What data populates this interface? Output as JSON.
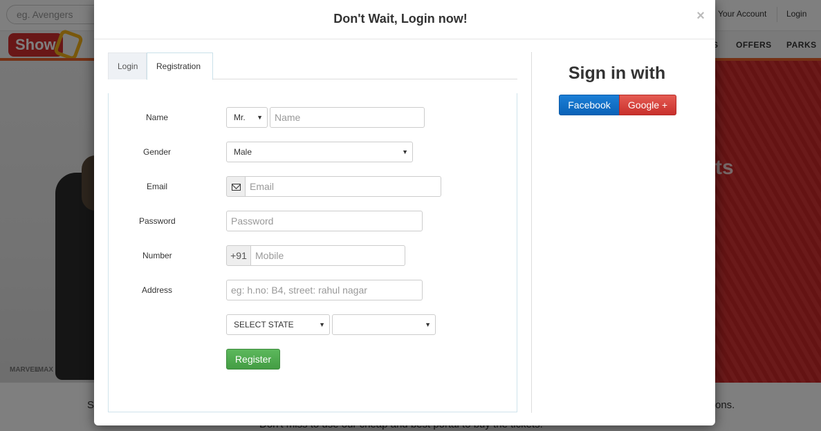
{
  "background": {
    "search_placeholder": "eg. Avengers",
    "top_links": [
      "Your Account",
      "Login"
    ],
    "logo_text": "Show",
    "nav_partial": "S",
    "nav_links": [
      "OFFERS",
      "PARKS"
    ],
    "brands": [
      "MARVEL",
      "IMAX"
    ],
    "hero_text": "ts",
    "bottom_s": "S",
    "bottom_ons": "ons.",
    "bottom_line": "Don't miss to use our cheap and best portal to buy the tickets."
  },
  "modal": {
    "title": "Don't Wait, Login now!",
    "close": "×",
    "tabs": [
      {
        "label": "Login",
        "active": false
      },
      {
        "label": "Registration",
        "active": true
      }
    ],
    "form": {
      "name_label": "Name",
      "title_select_value": "Mr.",
      "name_placeholder": "Name",
      "gender_label": "Gender",
      "gender_value": "Male",
      "email_label": "Email",
      "email_icon": "envelope-icon",
      "email_placeholder": "Email",
      "password_label": "Password",
      "password_placeholder": "Password",
      "number_label": "Number",
      "country_code": "+91",
      "mobile_placeholder": "Mobile",
      "address_label": "Address",
      "address_placeholder": "eg: h.no: B4, street: rahul nagar",
      "state_select_value": "SELECT STATE",
      "city_select_value": "",
      "register_label": "Register"
    },
    "signin": {
      "title": "Sign in with",
      "facebook_label": "Facebook",
      "google_label": "Google +"
    }
  },
  "colors": {
    "register_green": "#5cb85c",
    "facebook_blue": "#0b63b8",
    "google_red": "#d9534f",
    "brand_orange": "#e8622a"
  }
}
